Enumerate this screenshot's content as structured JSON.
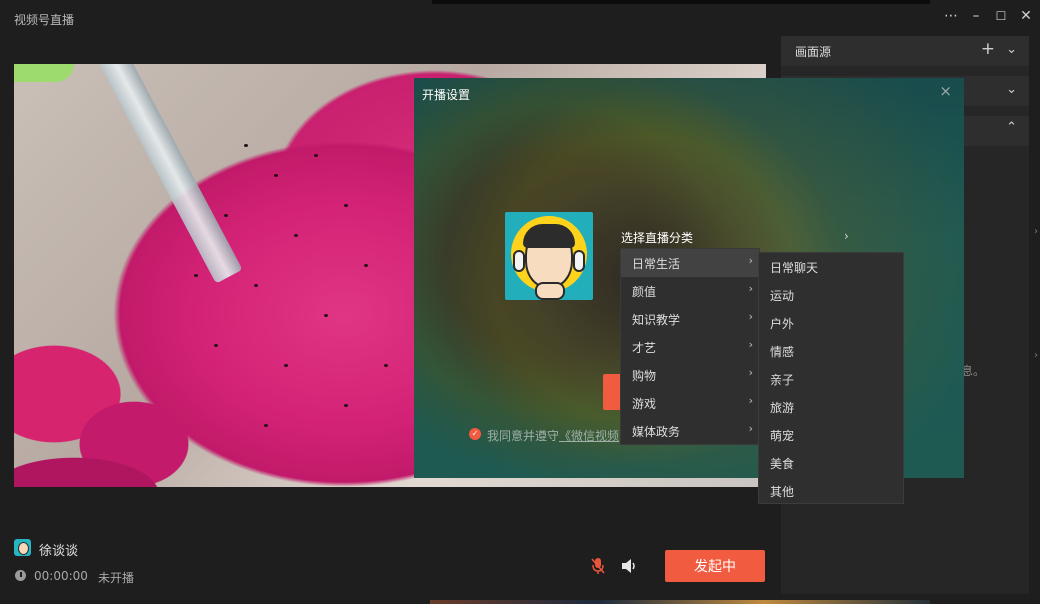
{
  "app": {
    "title": "视频号直播"
  },
  "window_controls": {
    "more": "⋯",
    "minimize": "–",
    "maximize": "☐",
    "close": "✕"
  },
  "right_panel": {
    "rows": [
      {
        "label": "画面源"
      },
      {
        "label": ""
      },
      {
        "label": ""
      }
    ],
    "overflow_text": "息。"
  },
  "user": {
    "name": "徐谈谈",
    "timer": "00:00:00",
    "status": "未开播"
  },
  "controls": {
    "start_button": "发起中"
  },
  "modal": {
    "title": "开播设置",
    "close": "×",
    "category_label": "选择直播分类",
    "agree_prefix": "我同意并遵守",
    "agree_link": "《微信视频"
  },
  "category_menu": [
    {
      "label": "日常生活",
      "active": true
    },
    {
      "label": "颜值"
    },
    {
      "label": "知识教学"
    },
    {
      "label": "才艺"
    },
    {
      "label": "购物"
    },
    {
      "label": "游戏"
    },
    {
      "label": "媒体政务"
    }
  ],
  "sub_menu": [
    "日常聊天",
    "运动",
    "户外",
    "情感",
    "亲子",
    "旅游",
    "萌宠",
    "美食",
    "其他"
  ],
  "colors": {
    "accent": "#f15b40",
    "background": "#1e1e1e",
    "panel": "#262626"
  }
}
